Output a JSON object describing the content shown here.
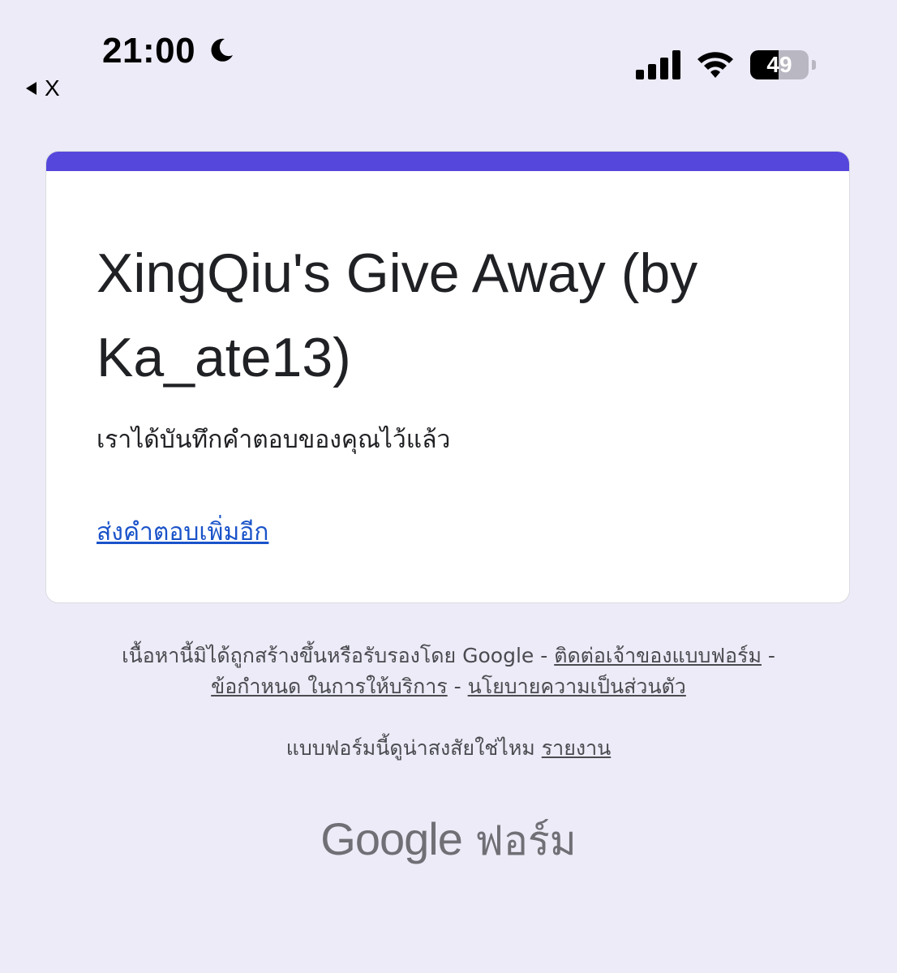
{
  "status_bar": {
    "time": "21:00",
    "moon_icon": "moon-icon",
    "back_label": "X",
    "signal_icon": "cellular-signal-icon",
    "wifi_icon": "wifi-icon",
    "battery_level": "49",
    "battery_fraction": 0.49
  },
  "card": {
    "accent_color": "#5647dc",
    "title": "XingQiu's Give Away (by Ka_ate13)",
    "confirmation": "เราได้บันทึกคำตอบของคุณไว้แล้ว",
    "resubmit_link": "ส่งคำตอบเพิ่มอีก"
  },
  "footer": {
    "disclaimer": "เนื้อหานี้มิได้ถูกสร้างขึ้นหรือรับรองโดย Google -",
    "contact_owner": "ติดต่อเจ้าของแบบฟอร์ม",
    "separator": "-",
    "terms": "ข้อกำหนด ในการให้บริการ",
    "privacy": "นโยบายความเป็นส่วนตัว",
    "suspicious": "แบบฟอร์มนี้ดูน่าสงสัยใช่ไหม",
    "report": "รายงาน"
  },
  "brand": {
    "google": "Google",
    "forms": "ฟอร์ม"
  }
}
